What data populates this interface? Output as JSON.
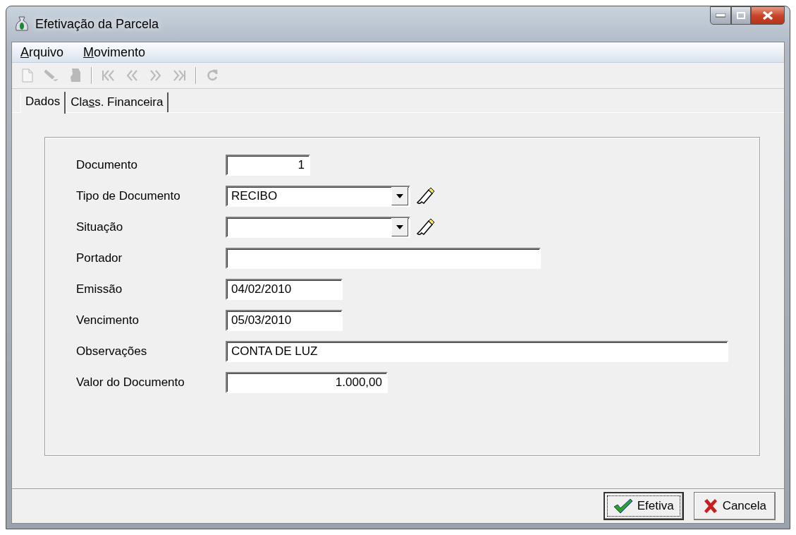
{
  "window": {
    "title": "Efetivação da Parcela"
  },
  "menu": [
    {
      "key": "A",
      "rest": "rquivo"
    },
    {
      "key": "M",
      "rest": "ovimento"
    }
  ],
  "toolbar": [
    {
      "kind": "new",
      "disabled": true
    },
    {
      "kind": "edit",
      "disabled": true
    },
    {
      "kind": "delete",
      "disabled": true
    },
    {
      "kind": "separator"
    },
    {
      "kind": "first",
      "disabled": true
    },
    {
      "kind": "prev",
      "disabled": true
    },
    {
      "kind": "next",
      "disabled": true
    },
    {
      "kind": "last",
      "disabled": true
    },
    {
      "kind": "separator"
    },
    {
      "kind": "refresh",
      "disabled": true
    }
  ],
  "tabs": [
    {
      "pre": "Dados",
      "selected": true
    },
    {
      "pre": "Cla",
      "key": "s",
      "rest": "s. Financeira",
      "selected": false
    }
  ],
  "fields": [
    {
      "label": "Documento",
      "kind": "number",
      "value": "1"
    },
    {
      "label": "Tipo de Documento",
      "kind": "combo",
      "value": "RECIBO"
    },
    {
      "label": "Situação",
      "kind": "combo"
    },
    {
      "label": "Portador",
      "kind": "text"
    },
    {
      "label": "Emissão",
      "kind": "text",
      "value": "04/02/2010"
    },
    {
      "label": "Vencimento",
      "kind": "text",
      "value": "05/03/2010"
    },
    {
      "label": "Observações",
      "kind": "text",
      "value": "CONTA DE LUZ"
    },
    {
      "label": "Valor do Documento",
      "kind": "number",
      "value": "1.000,00"
    }
  ],
  "buttons": [
    {
      "label": "Efetiva",
      "kind": "confirm",
      "focused": true
    },
    {
      "label": "Cancela",
      "kind": "cancel",
      "focused": false
    }
  ]
}
